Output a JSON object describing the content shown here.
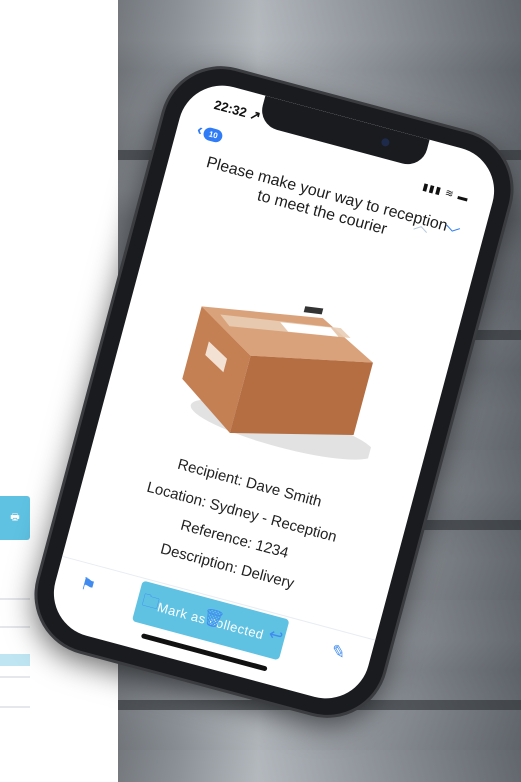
{
  "status_bar": {
    "time": "22:32 ↗",
    "icons": "▮▮▮ ≋ ▬"
  },
  "nav": {
    "back_badge": "10",
    "up_arrow": "︿",
    "down_arrow": "﹀"
  },
  "message": {
    "title_line1": "Please make your way to reception",
    "title_line2": "to meet the courier",
    "recipient": "Recipient: Dave Smith",
    "location": "Location: Sydney - Reception",
    "reference": "Reference: 1234",
    "description": "Description: Delivery",
    "button_label": "Mark as collected"
  },
  "toolbar": {
    "icons": [
      "flag-icon",
      "folder-icon",
      "trash-icon",
      "reply-icon",
      "compose-icon"
    ]
  },
  "colors": {
    "accent": "#5fc2e3",
    "ios_blue": "#2f7cf6"
  }
}
